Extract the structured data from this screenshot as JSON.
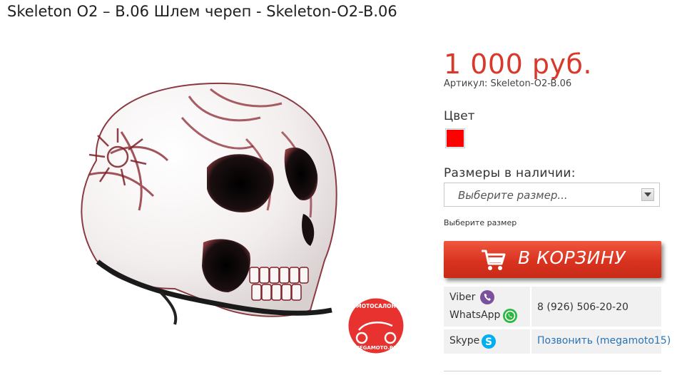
{
  "product": {
    "title": "Skeleton O2 – B.06 Шлем череп - Skeleton-O2-B.06",
    "price": "1 000 руб.",
    "sku_line": "Артикул: Skeleton-O2-B.06",
    "color_label": "Цвет",
    "color_swatch": "#ff0000",
    "sizes_label": "Размеры в наличии:",
    "size_select": {
      "selected": "Выберите размер..."
    },
    "size_hint": "Выберите размер",
    "cart_button": "В КОРЗИНУ"
  },
  "watermark": {
    "top": "МОТОСАЛОН",
    "bottom": "MEGAMOTO.RU"
  },
  "contacts": {
    "viber_label": "Viber",
    "whatsapp_label": "WhatsApp",
    "phone": "8 (926) 506-20-20",
    "skype_label": "Skype",
    "skype_link": "Позвонить (megamoto15)"
  },
  "colors": {
    "price": "#d9392b",
    "cart_button": "#d9331f",
    "viber": "#7b519d",
    "whatsapp": "#2bb741",
    "skype": "#00aff0",
    "link": "#2a74b5"
  },
  "icons": [
    "cart-icon",
    "viber-icon",
    "whatsapp-icon",
    "skype-icon",
    "dropdown-arrow-icon"
  ]
}
